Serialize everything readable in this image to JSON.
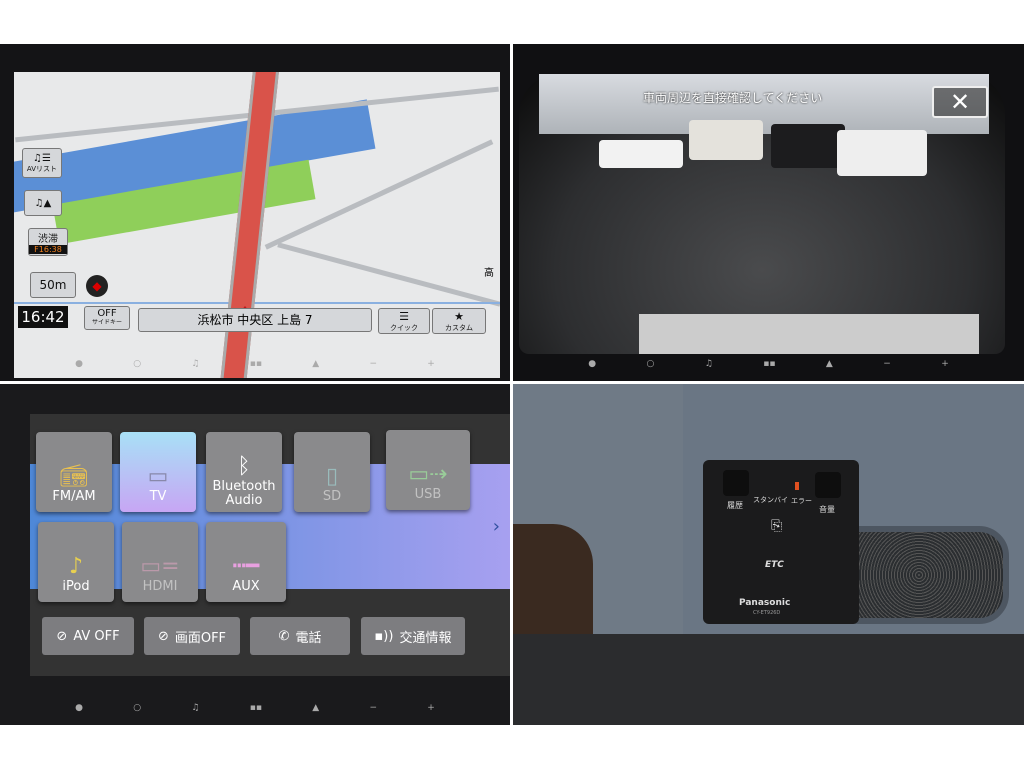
{
  "navigation_map": {
    "av_list_icon": "music-list-icon",
    "av_list_label": "AVリスト",
    "audio_nav_icon": "music-arrow-icon",
    "traffic_label": "渋滞",
    "traffic_time": "F16:38",
    "scale": "50m",
    "clock": "16:42",
    "side_key_state": "OFF",
    "side_key_label": "サイドキー",
    "address": "浜松市 中央区 上島 7",
    "quick_label": "クイック",
    "custom_label": "カスタム",
    "map_edge_label": "高"
  },
  "rear_camera": {
    "warning": "車両周辺を直接確認してください",
    "close_icon": "close-icon"
  },
  "av_source_menu": {
    "sources": [
      {
        "label": "FM/AM",
        "icon": "radio-icon",
        "enabled": true,
        "selected": false
      },
      {
        "label": "TV",
        "icon": "tv-icon",
        "enabled": true,
        "selected": true
      },
      {
        "label": "Bluetooth Audio",
        "icon": "bluetooth-icon",
        "enabled": true,
        "selected": false
      },
      {
        "label": "SD",
        "icon": "sd-card-icon",
        "enabled": false,
        "selected": false
      },
      {
        "label": "USB",
        "icon": "usb-icon",
        "enabled": false,
        "selected": false
      },
      {
        "label": "iPod",
        "icon": "music-note-icon",
        "enabled": true,
        "selected": false
      },
      {
        "label": "HDMI",
        "icon": "hdmi-icon",
        "enabled": false,
        "selected": false
      },
      {
        "label": "AUX",
        "icon": "aux-cable-icon",
        "enabled": true,
        "selected": false
      }
    ],
    "actions": [
      {
        "label": "AV OFF",
        "icon": "av-off-icon"
      },
      {
        "label": "画面OFF",
        "icon": "screen-off-icon"
      },
      {
        "label": "電話",
        "icon": "phone-icon"
      },
      {
        "label": "交通情報",
        "icon": "traffic-info-icon"
      }
    ]
  },
  "etc_unit": {
    "history_label": "履歴",
    "standby_label": "スタンバイ",
    "error_label": "エラー",
    "volume_label": "音量",
    "logo": "ETC",
    "brand": "Panasonic",
    "model": "CY-ET926D"
  }
}
